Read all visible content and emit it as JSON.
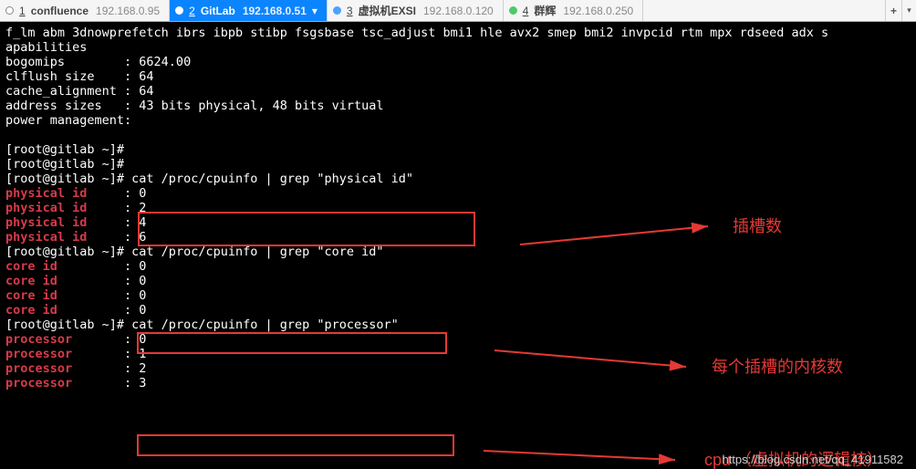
{
  "tabs": [
    {
      "num": "1",
      "name": "confluence",
      "addr": "192.168.0.95",
      "style": "plain",
      "active": false
    },
    {
      "num": "2",
      "name": "GitLab",
      "addr": "192.168.0.51",
      "style": "plain",
      "active": true,
      "chev": "▾"
    },
    {
      "num": "3",
      "name": "虚拟机EXSI",
      "addr": "192.168.0.120",
      "style": "blue",
      "active": false
    },
    {
      "num": "4",
      "name": "群辉",
      "addr": "192.168.0.250",
      "style": "green",
      "active": false
    }
  ],
  "plus_label": "+",
  "drop_label": "▾",
  "terminal": {
    "preamble": "f_lm abm 3dnowprefetch ibrs ibpb stibp fsgsbase tsc_adjust bmi1 hle avx2 smep bmi2 invpcid rtm mpx rdseed adx s",
    "apabilities": "apabilities",
    "kv": [
      [
        "bogomips",
        "6624.00"
      ],
      [
        "clflush size",
        "64"
      ],
      [
        "cache_alignment",
        "64"
      ],
      [
        "address sizes",
        "43 bits physical, 48 bits virtual"
      ],
      [
        "power management",
        ""
      ]
    ],
    "prompt": "[root@gitlab ~]# ",
    "cmd1": "cat /proc/cpuinfo | grep \"physical id\"",
    "phys": [
      [
        "physical id",
        "0"
      ],
      [
        "physical id",
        "2"
      ],
      [
        "physical id",
        "4"
      ],
      [
        "physical id",
        "6"
      ]
    ],
    "cmd2": "cat /proc/cpuinfo | grep \"core id\"",
    "core": [
      [
        "core id",
        "0"
      ],
      [
        "core id",
        "0"
      ],
      [
        "core id",
        "0"
      ],
      [
        "core id",
        "0"
      ]
    ],
    "cmd3": "cat /proc/cpuinfo | grep \"processor\"",
    "proc": [
      [
        "processor",
        "0"
      ],
      [
        "processor",
        "1"
      ],
      [
        "processor",
        "2"
      ],
      [
        "processor",
        "3"
      ]
    ]
  },
  "annotations": {
    "a1": "插槽数",
    "a2": "每个插槽的内核数",
    "a3": "cpu （虚拟机的逻辑核）"
  },
  "watermark": "https://blog.csdn.net/qq_41911582"
}
